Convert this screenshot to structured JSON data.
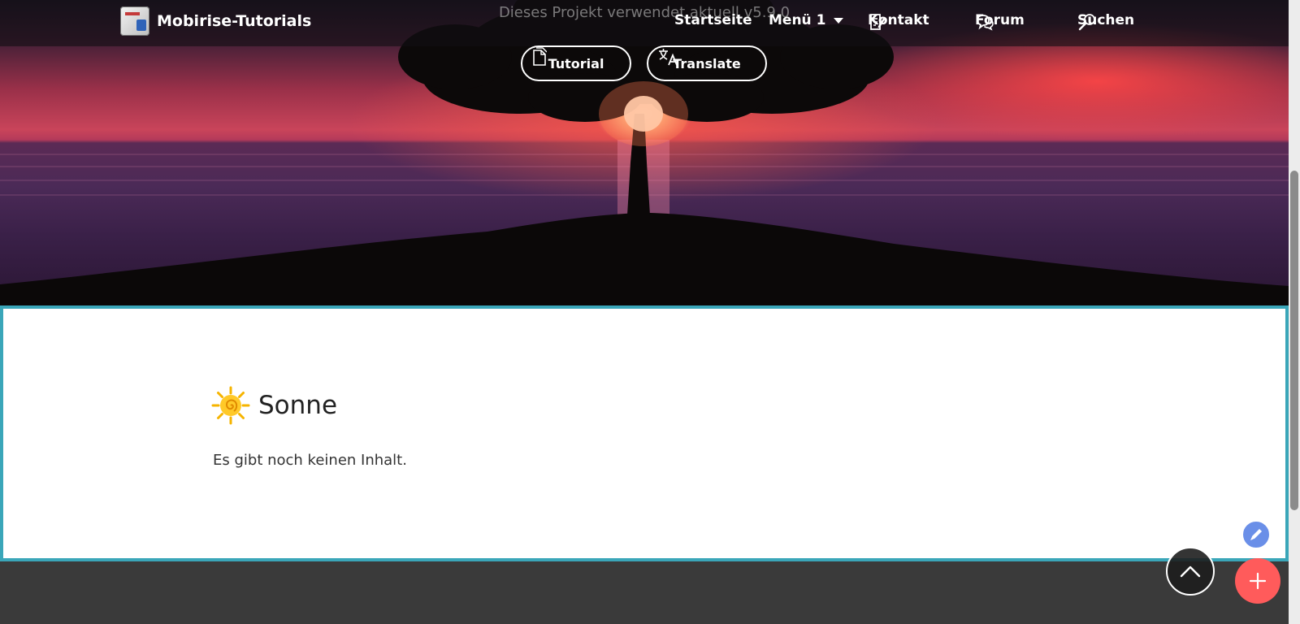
{
  "header": {
    "version_text": "Dieses Projekt verwendet aktuell v5.9.0",
    "brand": "Mobirise-Tutorials",
    "nav": {
      "home": "Startseite",
      "menu1": "Menü 1",
      "contact": "Kontakt",
      "forum": "Forum",
      "search": "Suchen"
    }
  },
  "buttons": {
    "tutorial": "Tutorial",
    "translate": "Translate"
  },
  "content": {
    "title": "Sonne",
    "body": "Es gibt noch keinen Inhalt."
  },
  "icons": {
    "contact": "note-edit-icon",
    "forum": "chat-bubbles-icon",
    "search": "magnifier-icon",
    "tutorial": "document-icon",
    "translate": "translate-icon",
    "title": "sun-icon",
    "edit": "pen-icon",
    "scroll_top": "chevron-up-icon",
    "add": "plus-icon"
  },
  "colors": {
    "content_border": "#3aa6b9",
    "add_button": "#ff5b5b",
    "edit_button": "#6a8fe8",
    "footer": "#3a3a3a"
  }
}
